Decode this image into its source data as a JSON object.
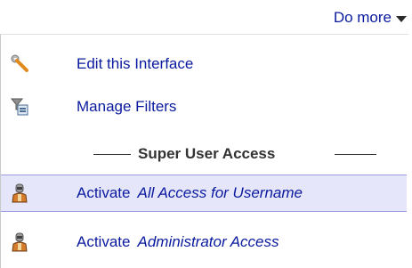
{
  "header": {
    "do_more_label": "Do more"
  },
  "menu": {
    "items": [
      {
        "label": "Edit this Interface",
        "icon": "wrench-icon"
      },
      {
        "label": "Manage Filters",
        "icon": "filter-icon"
      }
    ],
    "section_title": "Super User Access",
    "super_items": [
      {
        "prefix": "Activate",
        "target": "All Access for Username",
        "icon": "user-icon",
        "highlighted": true
      },
      {
        "prefix": "Activate",
        "target": "Administrator Access",
        "icon": "user-icon",
        "highlighted": false
      }
    ]
  },
  "colors": {
    "link": "#0a1a9e",
    "highlight_bg": "#e6e6fb",
    "highlight_border": "#9c9ce0"
  }
}
